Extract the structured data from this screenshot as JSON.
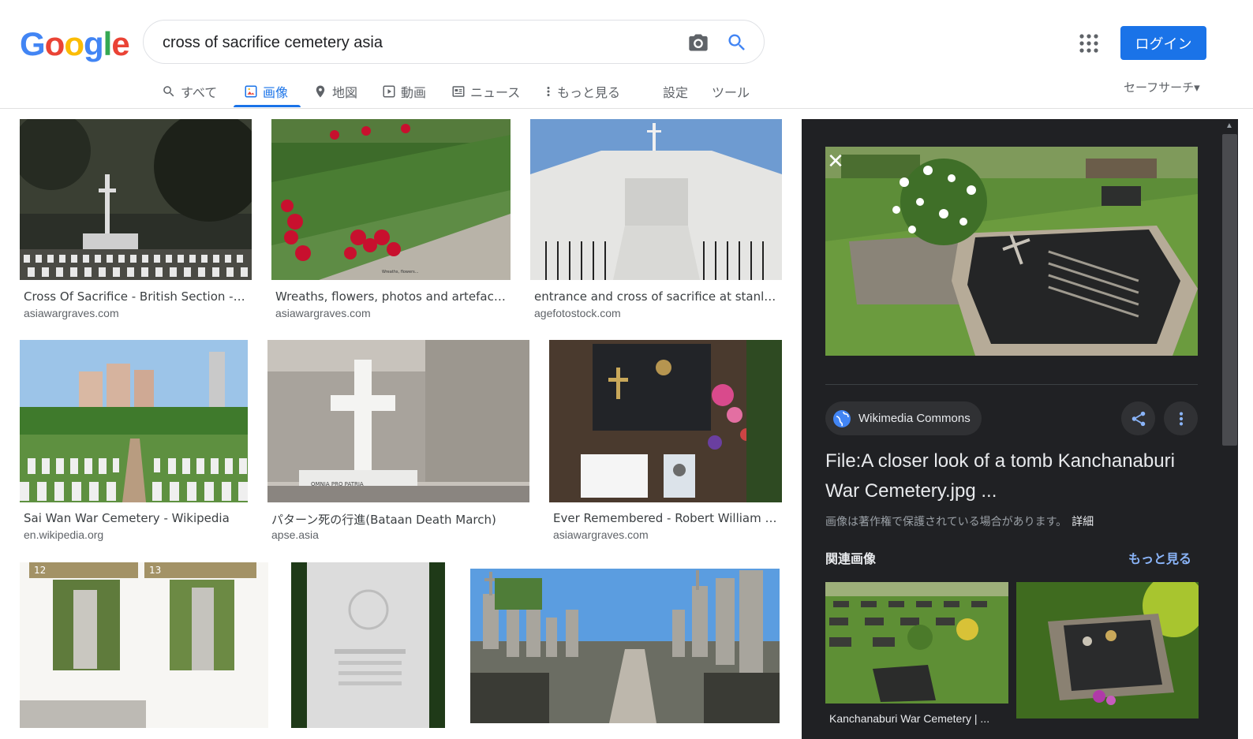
{
  "header": {
    "search_value": "cross of sacrifice cemetery asia",
    "login_label": "ログイン",
    "safesearch_label": "セーフサーチ▾"
  },
  "tabs": [
    {
      "label": "すべて",
      "icon": "search-icon"
    },
    {
      "label": "画像",
      "icon": "image-icon",
      "active": true
    },
    {
      "label": "地図",
      "icon": "map-pin-icon"
    },
    {
      "label": "動画",
      "icon": "video-icon"
    },
    {
      "label": "ニュース",
      "icon": "news-icon"
    },
    {
      "label": "もっと見る",
      "icon": "more-vert-icon"
    },
    {
      "label": "設定"
    },
    {
      "label": "ツール"
    }
  ],
  "results": [
    {
      "title": "Cross Of Sacrifice - British Section - CW...",
      "source": "asiawargraves.com"
    },
    {
      "title": "Wreaths, flowers, photos and artefacts at...",
      "source": "asiawargraves.com"
    },
    {
      "title": "entrance and cross of sacrifice at stanley m...",
      "source": "agefotostock.com"
    },
    {
      "title": "Sai Wan War Cemetery - Wikipedia",
      "source": "en.wikipedia.org"
    },
    {
      "title": "パターン死の行進(Bataan Death March)",
      "source": "apse.asia"
    },
    {
      "title": "Ever Remembered - Robert William Willo...",
      "source": "asiawargraves.com"
    },
    {
      "title": "",
      "source": "",
      "overlay": [
        "12",
        "13"
      ]
    },
    {
      "title": "",
      "source": ""
    },
    {
      "title": "",
      "source": ""
    }
  ],
  "panel": {
    "source_name": "Wikimedia Commons",
    "title": "File:A closer look of a tomb Kanchanaburi War Cemetery.jpg ...",
    "copyright": "画像は著作権で保護されている場合があります。",
    "details_link": "詳細",
    "related_heading": "関連画像",
    "more_link": "もっと見る",
    "related": [
      {
        "caption": "Kanchanaburi War Cemetery | ..."
      },
      {
        "caption": ""
      }
    ]
  },
  "colors": {
    "accent": "#1a73e8",
    "panel_bg": "#202124",
    "link_dark": "#8ab4f8"
  }
}
